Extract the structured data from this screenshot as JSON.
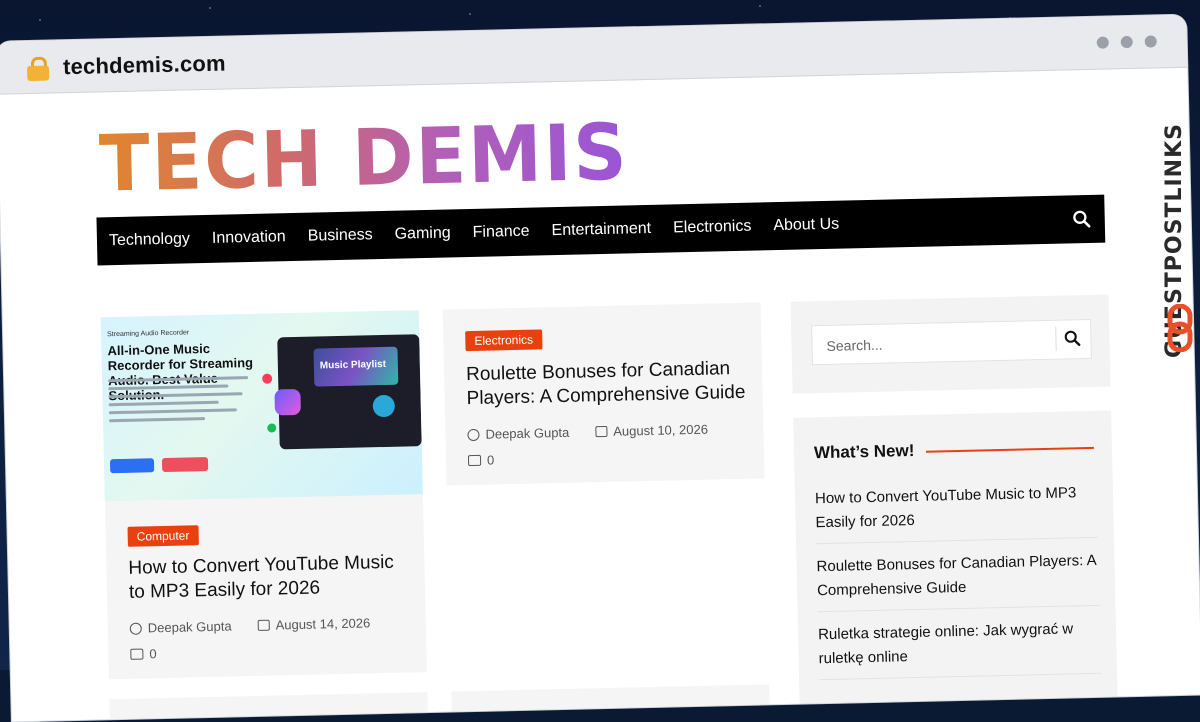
{
  "browser": {
    "url": "techdemis.com"
  },
  "site": {
    "logo": "TECH DEMIS"
  },
  "nav": {
    "items": [
      "Technology",
      "Innovation",
      "Business",
      "Gaming",
      "Finance",
      "Entertainment",
      "Electronics",
      "About Us"
    ]
  },
  "posts": [
    {
      "category": "Computer",
      "title": "How to Convert YouTube Music to MP3 Easily for 2026",
      "author": "Deepak Gupta",
      "date": "August 14, 2026",
      "comments": "0",
      "thumbnail": {
        "kicker": "Streaming Audio Recorder",
        "headline": "All-in-One Music Recorder for Streaming Audio. Best Value Solution.",
        "playlist_label": "Music Playlist"
      }
    },
    {
      "category": "Electronics",
      "title": "Roulette Bonuses for Canadian Players: A Comprehensive Guide",
      "author": "Deepak Gupta",
      "date": "August 10, 2026",
      "comments": "0"
    }
  ],
  "sidebar": {
    "search_placeholder": "Search...",
    "whats_new_title": "What’s New!",
    "whats_new_items": [
      "How to Convert YouTube Music to MP3 Easily for 2026",
      "Roulette Bonuses for Canadian Players: A Comprehensive Guide",
      "Ruletka strategie online: Jak wygrać w ruletkę online"
    ]
  },
  "watermark": {
    "text": "GUESTPOSTLINKS"
  },
  "colors": {
    "accent": "#e8400f",
    "nav_bg": "#000000"
  }
}
